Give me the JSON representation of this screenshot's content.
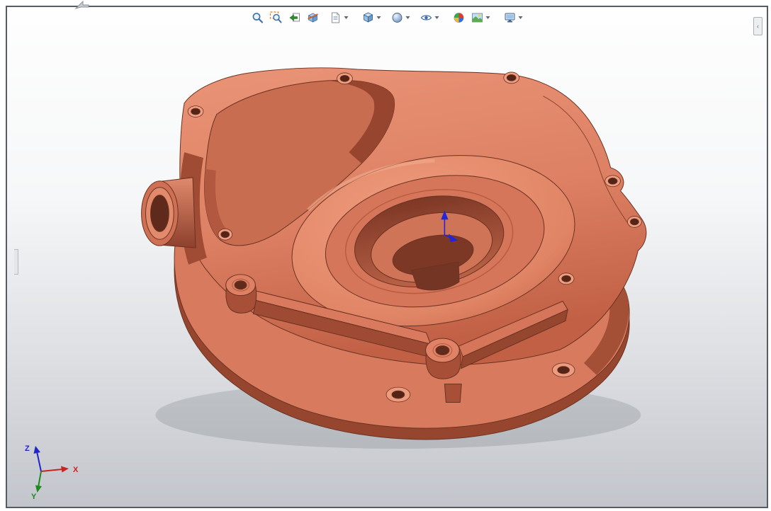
{
  "toolbar": {
    "items": [
      {
        "name": "zoom-to-fit",
        "has_dropdown": false
      },
      {
        "name": "zoom-to-area",
        "has_dropdown": false
      },
      {
        "name": "previous-view",
        "has_dropdown": false
      },
      {
        "name": "section-view",
        "has_dropdown": false
      },
      {
        "name": "annotation-views",
        "has_dropdown": true
      },
      {
        "name": "view-orientation",
        "has_dropdown": true
      },
      {
        "name": "display-style",
        "has_dropdown": true
      },
      {
        "name": "hide-show-items",
        "has_dropdown": true
      },
      {
        "name": "edit-appearance",
        "has_dropdown": false
      },
      {
        "name": "apply-scene",
        "has_dropdown": true
      },
      {
        "name": "view-settings",
        "has_dropdown": true
      }
    ]
  },
  "triad": {
    "axes": [
      {
        "label": "X",
        "color": "#cc2222"
      },
      {
        "label": "Y",
        "color": "#1d8a1d"
      },
      {
        "label": "Z",
        "color": "#2424cc"
      }
    ]
  },
  "viewport": {
    "background_top": "#ffffff",
    "background_bottom": "#c2c5cb",
    "border_color": "#565c64"
  },
  "model": {
    "body_color": "#dd8063",
    "dark_face_color": "#a04b33",
    "edge_color": "#6b3222",
    "origin_marker_color": "#2424dd"
  }
}
